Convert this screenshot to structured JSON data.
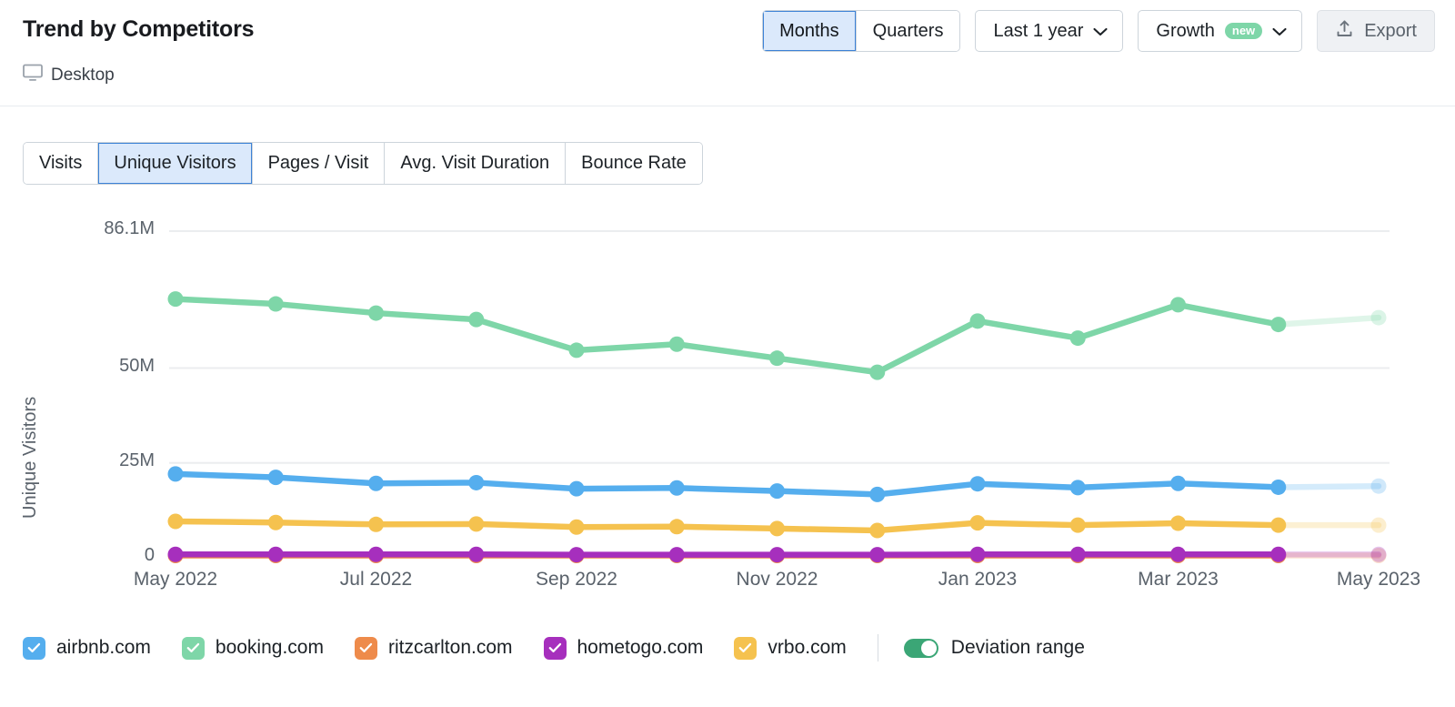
{
  "header": {
    "title": "Trend by Competitors",
    "device_label": "Desktop",
    "device_icon": "monitor-icon",
    "granularity": {
      "options": [
        "Months",
        "Quarters"
      ],
      "selected": "Months"
    },
    "date_range": {
      "label": "Last 1 year",
      "icon": "chevron-down-icon"
    },
    "metric_mode": {
      "label": "Growth",
      "badge": "new",
      "icon": "chevron-down-icon"
    },
    "export": {
      "label": "Export",
      "icon": "export-icon"
    }
  },
  "metric_tabs": {
    "items": [
      "Visits",
      "Unique Visitors",
      "Pages / Visit",
      "Avg. Visit Duration",
      "Bounce Rate"
    ],
    "selected": "Unique Visitors"
  },
  "legend": {
    "items": [
      {
        "label": "airbnb.com",
        "color": "#55aeee",
        "checked": true
      },
      {
        "label": "booking.com",
        "color": "#7ed6a8",
        "checked": true
      },
      {
        "label": "ritzcarlton.com",
        "color": "#ee8b4b",
        "checked": true
      },
      {
        "label": "hometogo.com",
        "color": "#a62fbd",
        "checked": true
      },
      {
        "label": "vrbo.com",
        "color": "#f5c24f",
        "checked": true
      }
    ],
    "deviation_range": {
      "label": "Deviation range",
      "enabled": true,
      "color": "#3ba676"
    }
  },
  "chart_data": {
    "type": "line",
    "title": "Trend by Competitors",
    "xlabel": "",
    "ylabel": "Unique Visitors",
    "ylim": [
      0,
      86100000
    ],
    "yticks": [
      0,
      25000000,
      50000000,
      86100000
    ],
    "ytick_labels": [
      "0",
      "25M",
      "50M",
      "86.1M"
    ],
    "grid": true,
    "legend_position": "bottom",
    "x": [
      "May 2022",
      "Jun 2022",
      "Jul 2022",
      "Aug 2022",
      "Sep 2022",
      "Oct 2022",
      "Nov 2022",
      "Dec 2022",
      "Jan 2023",
      "Feb 2023",
      "Mar 2023",
      "Apr 2023",
      "May 2023"
    ],
    "xtick_labels": [
      "May 2022",
      "Jul 2022",
      "Sep 2022",
      "Nov 2022",
      "Jan 2023",
      "Mar 2023",
      "May 2023"
    ],
    "xtick_indices": [
      0,
      2,
      4,
      6,
      8,
      10,
      12
    ],
    "forecast_from_index": 11,
    "series": [
      {
        "name": "booking.com",
        "color": "#7ed6a8",
        "values": [
          68.2,
          66.9,
          64.5,
          62.8,
          54.7,
          56.3,
          52.6,
          48.9,
          62.4,
          57.9,
          66.7,
          61.5,
          63.3
        ]
      },
      {
        "name": "airbnb.com",
        "color": "#55aeee",
        "values": [
          22.1,
          21.2,
          19.6,
          19.8,
          18.2,
          18.4,
          17.6,
          16.7,
          19.5,
          18.5,
          19.6,
          18.6,
          18.9
        ]
      },
      {
        "name": "vrbo.com",
        "color": "#f5c24f",
        "values": [
          9.6,
          9.3,
          8.8,
          8.9,
          8.1,
          8.2,
          7.7,
          7.2,
          9.2,
          8.6,
          9.1,
          8.6,
          8.6
        ]
      },
      {
        "name": "hometogo.com",
        "color": "#a62fbd",
        "values": [
          0.9,
          0.9,
          0.9,
          0.9,
          0.8,
          0.8,
          0.8,
          0.8,
          0.9,
          0.9,
          0.9,
          0.9,
          0.9
        ]
      },
      {
        "name": "ritzcarlton.com",
        "color": "#ee8b4b",
        "values": [
          0.6,
          0.6,
          0.6,
          0.6,
          0.6,
          0.6,
          0.6,
          0.6,
          0.6,
          0.6,
          0.6,
          0.6,
          0.6
        ]
      }
    ],
    "value_unit": "M"
  }
}
